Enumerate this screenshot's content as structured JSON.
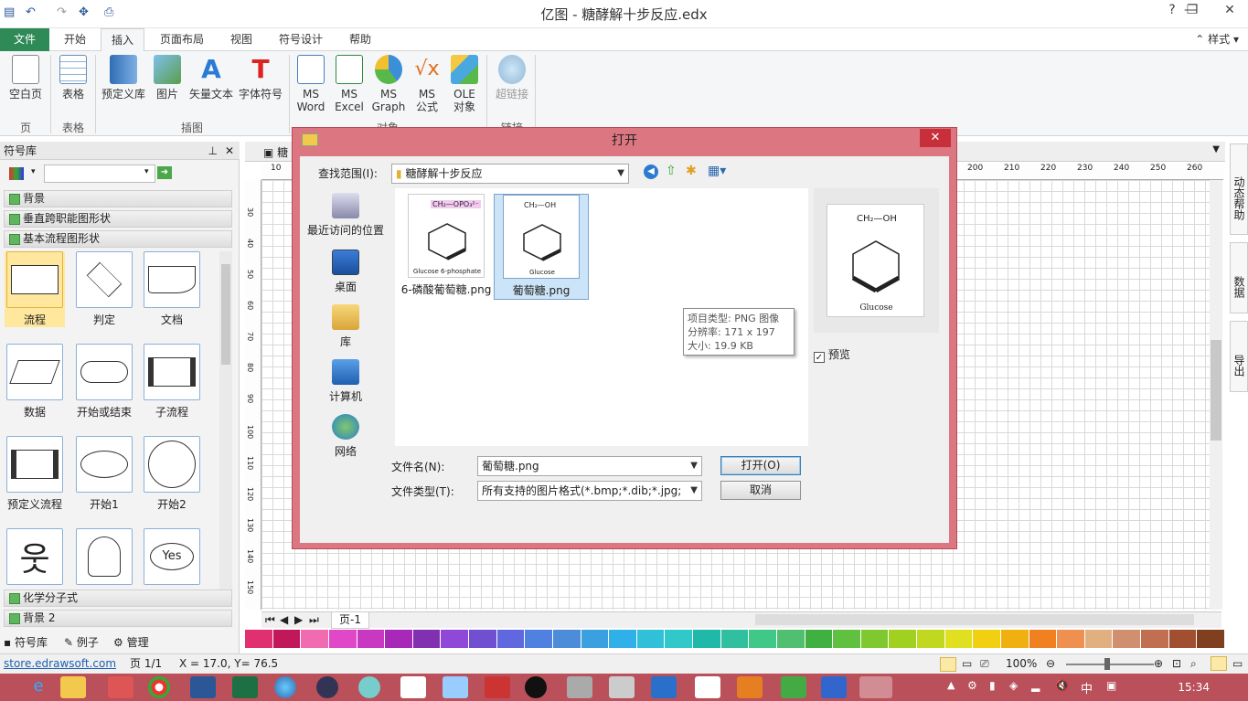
{
  "window": {
    "title": "亿图 - 糖酵解十步反应.edx"
  },
  "ribbon": {
    "tabs": [
      "文件",
      "开始",
      "插入",
      "页面布局",
      "视图",
      "符号设计",
      "帮助"
    ],
    "active_tab": "插入",
    "style_menu": "样式",
    "buttons": {
      "blank_page": "空白页",
      "table": "表格",
      "predefined_lib": "预定义库",
      "picture": "图片",
      "vector_text": "矢量文本",
      "font_symbol": "字体符号",
      "ms_word_1": "MS",
      "ms_word_2": "Word",
      "ms_excel_1": "MS",
      "ms_excel_2": "Excel",
      "ms_graph_1": "MS",
      "ms_graph_2": "Graph",
      "ms_formula_1": "MS",
      "ms_formula_2": "公式",
      "ole_1": "OLE",
      "ole_2": "对象",
      "hyperlink": "超链接"
    },
    "groups": {
      "page": "页",
      "table": "表格",
      "illustration": "插图",
      "object": "对象",
      "link": "链接"
    }
  },
  "symbol_library": {
    "title": "符号库",
    "categories_top": [
      "背景",
      "垂直跨职能图形状",
      "基本流程图形状"
    ],
    "shapes": [
      {
        "label": "流程",
        "selected": true
      },
      {
        "label": "判定"
      },
      {
        "label": "文档"
      },
      {
        "label": "数据"
      },
      {
        "label": "开始或结束"
      },
      {
        "label": "子流程"
      },
      {
        "label": "预定义流程"
      },
      {
        "label": "开始1"
      },
      {
        "label": "开始2"
      },
      {
        "label": ""
      },
      {
        "label": ""
      },
      {
        "label": "Yes"
      }
    ],
    "categories_bottom": [
      "化学分子式",
      "背景 2"
    ],
    "bottom_tabs": [
      "符号库",
      "例子",
      "管理"
    ]
  },
  "canvas": {
    "doc_tab": "糖",
    "ruler_labels": [
      "10",
      "200",
      "210",
      "220",
      "230",
      "240",
      "250",
      "260"
    ],
    "vruler_labels": [
      "30",
      "40",
      "50",
      "60",
      "70",
      "80",
      "90",
      "100",
      "110",
      "120",
      "130",
      "140",
      "150",
      "160"
    ],
    "page_tab": "页-1"
  },
  "side_tabs": [
    "动态帮助",
    "数据",
    "导出"
  ],
  "status": {
    "website": "store.edrawsoft.com",
    "page": "页 1/1",
    "coords": "X = 17.0, Y= 76.5",
    "zoom": "100%"
  },
  "taskbar": {
    "time": "15:34",
    "ime": "中"
  },
  "dialog": {
    "title": "打开",
    "look_in_label": "查找范围(I):",
    "look_in_value": "糖酵解十步反应",
    "nav": [
      "最近访问的位置",
      "桌面",
      "库",
      "计算机",
      "网络"
    ],
    "files": [
      {
        "name": "6-磷酸葡萄糖.png",
        "caption": "Glucose 6-phosphate",
        "top_group": "CH₂—OPO₃²⁻"
      },
      {
        "name": "葡萄糖.png",
        "caption": "Glucose",
        "top_group": "CH₂—OH",
        "selected": true
      }
    ],
    "tooltip": {
      "type": "项目类型: PNG 图像",
      "resolution": "分辨率: 171 x 197",
      "size": "大小: 19.9 KB"
    },
    "preview_checkbox": "预览",
    "preview_caption": "Glucose",
    "filename_label": "文件名(N):",
    "filename_value": "葡萄糖.png",
    "filetype_label": "文件类型(T):",
    "filetype_value": "所有支持的图片格式(*.bmp;*.dib;*.jpg;",
    "open_button": "打开(O)",
    "cancel_button": "取消"
  },
  "palette_colors": [
    "#e03070",
    "#c0185a",
    "#f06bb0",
    "#e048c8",
    "#c838c0",
    "#a828b8",
    "#8030b0",
    "#9048d8",
    "#7050d0",
    "#6068e0",
    "#5080e0",
    "#4c8cd8",
    "#3aa0e0",
    "#30b0e8",
    "#30c0d8",
    "#30c8c8",
    "#20b8a8",
    "#30c0a0",
    "#40c888",
    "#50c070",
    "#40b040",
    "#60c040",
    "#80c830",
    "#a0d020",
    "#c0d820",
    "#e0e020",
    "#f0d010",
    "#f0b010",
    "#f08020",
    "#f09050",
    "#e0b080",
    "#d09070",
    "#c07050",
    "#a05030",
    "#804020"
  ]
}
